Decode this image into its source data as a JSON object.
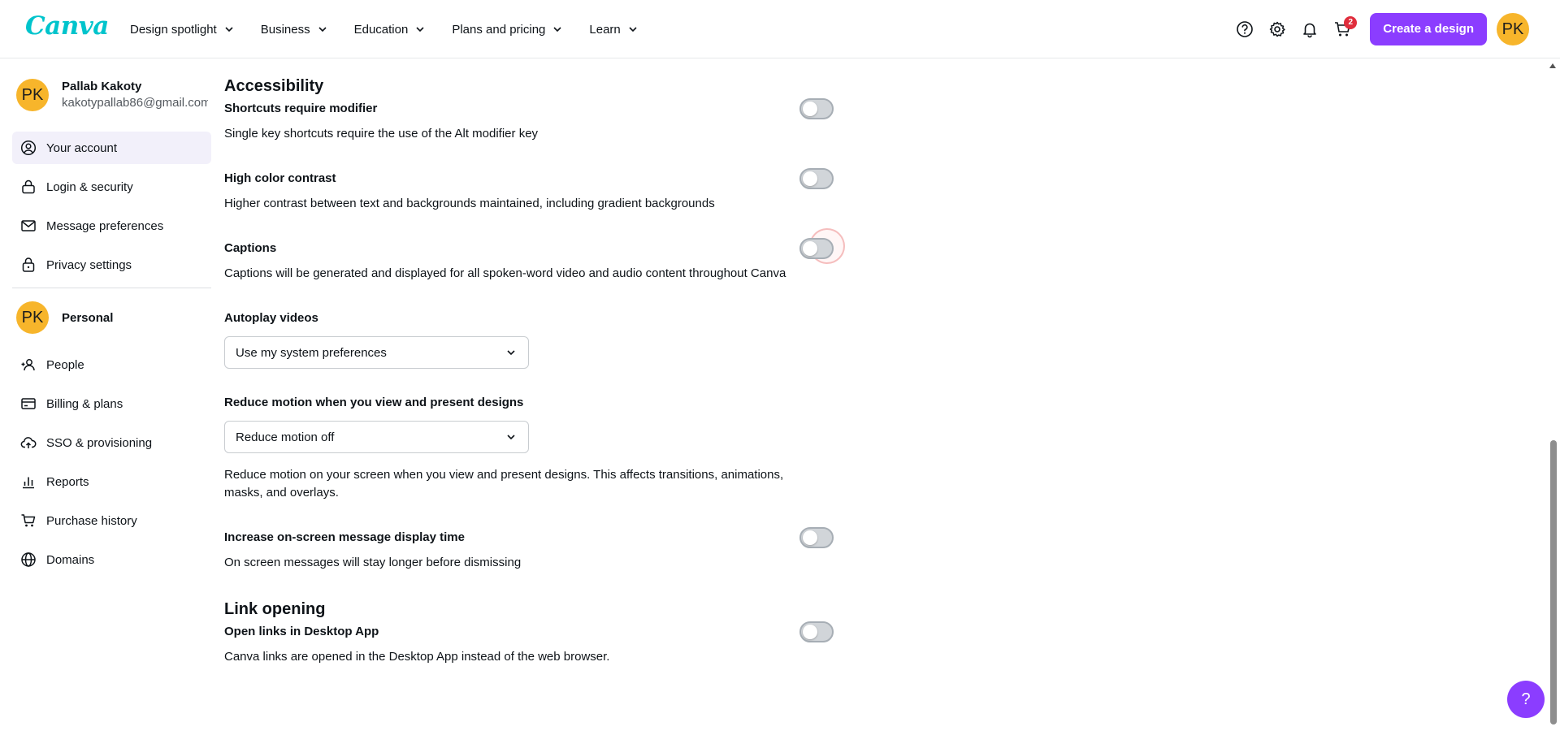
{
  "logo": "Canva",
  "nav": {
    "items": [
      {
        "label": "Design spotlight"
      },
      {
        "label": "Business"
      },
      {
        "label": "Education"
      },
      {
        "label": "Plans and pricing"
      },
      {
        "label": "Learn"
      }
    ]
  },
  "header": {
    "cart_count": "2",
    "create_label": "Create a design",
    "avatar_initials": "PK"
  },
  "sidebar": {
    "profile": {
      "initials": "PK",
      "name": "Pallab Kakoty",
      "email": "kakotypallab86@gmail.com"
    },
    "account_items": [
      {
        "label": "Your account",
        "icon": "user-circle-icon",
        "active": true
      },
      {
        "label": "Login & security",
        "icon": "lock-icon"
      },
      {
        "label": "Message preferences",
        "icon": "envelope-icon"
      },
      {
        "label": "Privacy settings",
        "icon": "padlock-icon"
      }
    ],
    "team": {
      "initials": "PK",
      "name": "Personal"
    },
    "team_items": [
      {
        "label": "People",
        "icon": "people-add-icon"
      },
      {
        "label": "Billing & plans",
        "icon": "billing-card-icon"
      },
      {
        "label": "SSO & provisioning",
        "icon": "cloud-upload-icon"
      },
      {
        "label": "Reports",
        "icon": "bar-chart-icon"
      },
      {
        "label": "Purchase history",
        "icon": "cart-icon"
      },
      {
        "label": "Domains",
        "icon": "globe-icon"
      }
    ]
  },
  "accessibility": {
    "title": "Accessibility",
    "shortcuts": {
      "title": "Shortcuts require modifier",
      "desc": "Single key shortcuts require the use of the Alt modifier key",
      "enabled": false
    },
    "contrast": {
      "title": "High color contrast",
      "desc": "Higher contrast between text and backgrounds maintained, including gradient backgrounds",
      "enabled": false
    },
    "captions": {
      "title": "Captions",
      "desc": "Captions will be generated and displayed for all spoken-word video and audio content throughout Canva",
      "enabled": false
    },
    "autoplay": {
      "title": "Autoplay videos",
      "value": "Use my system preferences"
    },
    "reduce_motion": {
      "title": "Reduce motion when you view and present designs",
      "value": "Reduce motion off",
      "desc": "Reduce motion on your screen when you view and present designs. This affects transitions, animations, masks, and overlays."
    },
    "message_time": {
      "title": "Increase on-screen message display time",
      "desc": "On screen messages will stay longer before dismissing",
      "enabled": false
    }
  },
  "link_opening": {
    "title": "Link opening",
    "desktop_app": {
      "title": "Open links in Desktop App",
      "desc": "Canva links are opened in the Desktop App instead of the web browser.",
      "enabled": false
    }
  },
  "help_fab": "?",
  "colors": {
    "brand": "#8b3dff",
    "logo": "#00c4cc",
    "avatar": "#f7b52b",
    "badge": "#e02d3c",
    "active_item_bg": "#f2f0fa"
  }
}
